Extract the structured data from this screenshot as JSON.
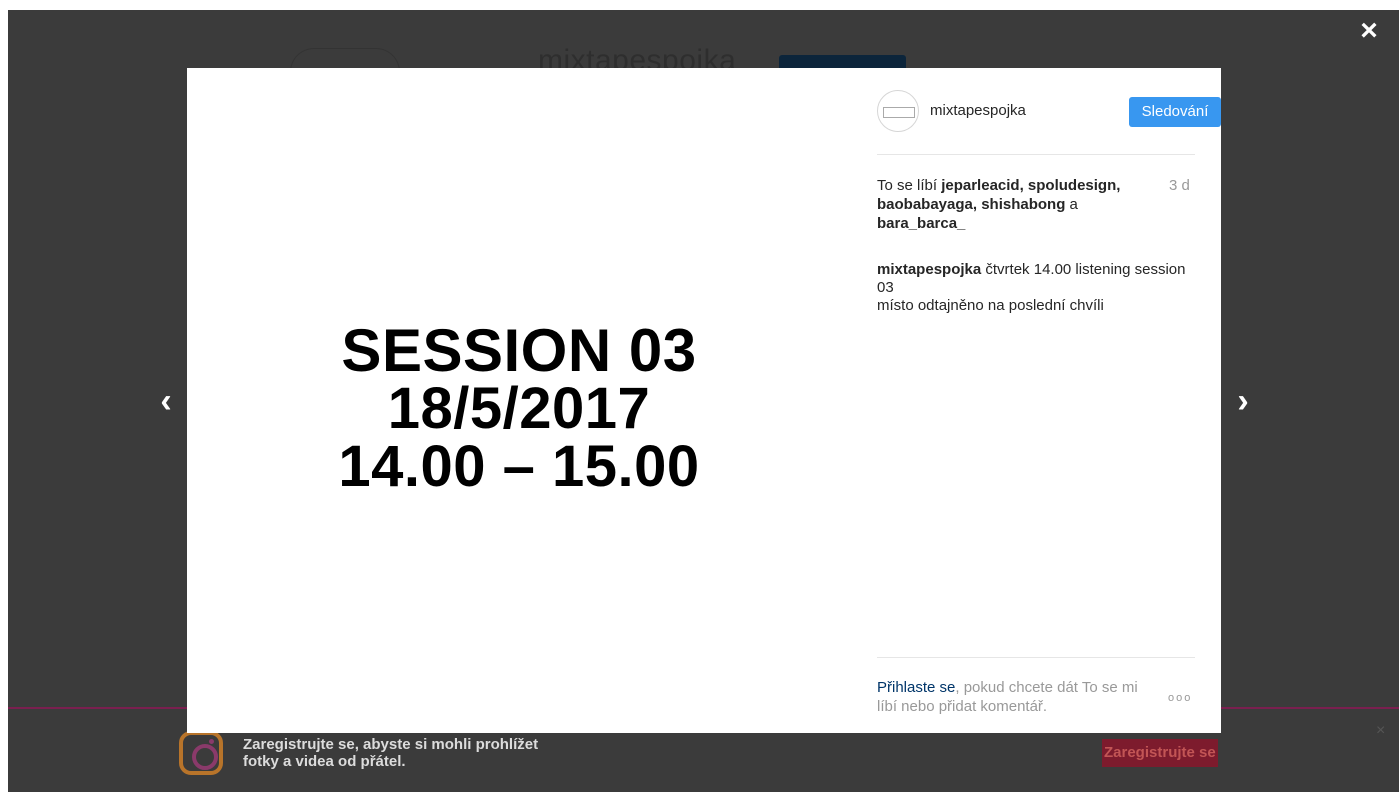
{
  "background": {
    "username": "mixtapespojka"
  },
  "overlay": {
    "close_label": "×",
    "prev_label": "‹",
    "next_label": "›"
  },
  "post": {
    "image_lines": [
      "SESSION 03",
      "18/5/2017",
      "14.00 – 15.00"
    ],
    "author": "mixtapespojka",
    "follow_label": "Sledování",
    "likes": {
      "prefix": "To se líbí ",
      "users_a": "jeparleacid, spoludesign, baobabayaga, shishabong",
      "connector": " a ",
      "users_b": "bara_barca_"
    },
    "time_ago": "3 d",
    "caption": {
      "author": "mixtapespojka",
      "text": " čtvrtek 14.00 listening session 03",
      "line2": "místo odtajněno na poslední chvíli"
    },
    "login": {
      "link": "Přihlaste se",
      "text": ", pokud chcete dát To se mi líbí nebo přidat komentář."
    },
    "more_label": "ooo"
  },
  "banner": {
    "text": "Zaregistrujte se, abyste si mohli prohlížet fotky a videa od přátel.",
    "button_label": "Zaregistrujte se",
    "close_label": "×"
  },
  "colors": {
    "follow_button": "#3897f0",
    "link": "#003569",
    "overlay": "#000000"
  }
}
